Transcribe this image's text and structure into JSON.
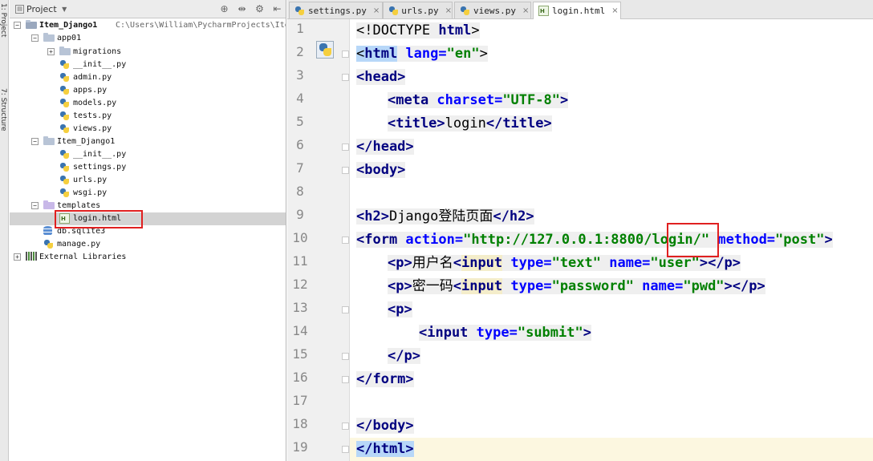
{
  "toolstrip": {
    "project_tab": "1: Project",
    "structure_tab": "7: Structure"
  },
  "project_panel": {
    "title": "Project",
    "tree": [
      {
        "name": "Item_Django1",
        "hint": "C:\\Users\\William\\PycharmProjects\\Ite",
        "kind": "module",
        "level": 0
      },
      {
        "name": "app01",
        "kind": "folder",
        "level": 1
      },
      {
        "name": "migrations",
        "kind": "folder",
        "level": 2
      },
      {
        "name": "__init__.py",
        "kind": "py",
        "level": 2
      },
      {
        "name": "admin.py",
        "kind": "py",
        "level": 2
      },
      {
        "name": "apps.py",
        "kind": "py",
        "level": 2
      },
      {
        "name": "models.py",
        "kind": "py",
        "level": 2
      },
      {
        "name": "tests.py",
        "kind": "py",
        "level": 2
      },
      {
        "name": "views.py",
        "kind": "py",
        "level": 2
      },
      {
        "name": "Item_Django1",
        "kind": "folder",
        "level": 1
      },
      {
        "name": "__init__.py",
        "kind": "py",
        "level": 2
      },
      {
        "name": "settings.py",
        "kind": "py",
        "level": 2
      },
      {
        "name": "urls.py",
        "kind": "py",
        "level": 2
      },
      {
        "name": "wsgi.py",
        "kind": "py",
        "level": 2
      },
      {
        "name": "templates",
        "kind": "tmpl",
        "level": 1
      },
      {
        "name": "login.html",
        "kind": "html",
        "level": 2
      },
      {
        "name": "db.sqlite3",
        "kind": "db",
        "level": 1
      },
      {
        "name": "manage.py",
        "kind": "py",
        "level": 1
      },
      {
        "name": "External Libraries",
        "kind": "lib",
        "level": 0
      }
    ]
  },
  "editor": {
    "tabs": [
      {
        "label": "settings.py",
        "kind": "py"
      },
      {
        "label": "urls.py",
        "kind": "py"
      },
      {
        "label": "views.py",
        "kind": "py"
      },
      {
        "label": "login.html",
        "kind": "html"
      }
    ],
    "line_numbers": [
      "1",
      "2",
      "3",
      "4",
      "5",
      "6",
      "7",
      "8",
      "9",
      "10",
      "11",
      "12",
      "13",
      "14",
      "15",
      "16",
      "17",
      "18",
      "19"
    ],
    "code": {
      "l1": {
        "a": "<!DOCTYPE ",
        "b": "html",
        "c": ">"
      },
      "l2": {
        "open": "<",
        "tag": "html",
        "attr": " lang=",
        "val": "\"en\"",
        "close": ">"
      },
      "l3": {
        "text": "<head>"
      },
      "l4": {
        "open": "<meta",
        "attr": " charset=",
        "val": "\"UTF-8\"",
        "close": ">"
      },
      "l5": {
        "open": "<title>",
        "text": "login",
        "close": "</title>"
      },
      "l6": {
        "text": "</head>"
      },
      "l7": {
        "text": "<body>"
      },
      "l9": {
        "open": "<h2>",
        "text": "Django登陆页面",
        "close": "</h2>"
      },
      "l10": {
        "open": "<form",
        "attr1": " action=",
        "val1a": "\"http://127.0.0.1:8800/",
        "val1b": "login",
        "val1c": "/\"",
        "attr2": " method=",
        "val2": "\"post\"",
        "close": ">"
      },
      "l11": {
        "p": "<p>",
        "text": "用户名",
        "lt": "<",
        "input": "input",
        "attr1": " type=",
        "val1": "\"text\"",
        "attr2": " name=",
        "val2": "\"user\"",
        "close": "></p>"
      },
      "l12": {
        "p": "<p>",
        "text": "密一码",
        "lt": "<",
        "input": "input",
        "attr1": " type=",
        "val1": "\"password\"",
        "attr2": " name=",
        "val2": "\"pwd\"",
        "close": "></p>"
      },
      "l13": {
        "text": "<p>"
      },
      "l14": {
        "open": "<input",
        "attr": " type=",
        "val": "\"submit\"",
        "close": ">"
      },
      "l15": {
        "text": "</p>"
      },
      "l16": {
        "text": "</form>"
      },
      "l18": {
        "text": "</body>"
      },
      "l19": {
        "text": "</html>"
      }
    }
  }
}
